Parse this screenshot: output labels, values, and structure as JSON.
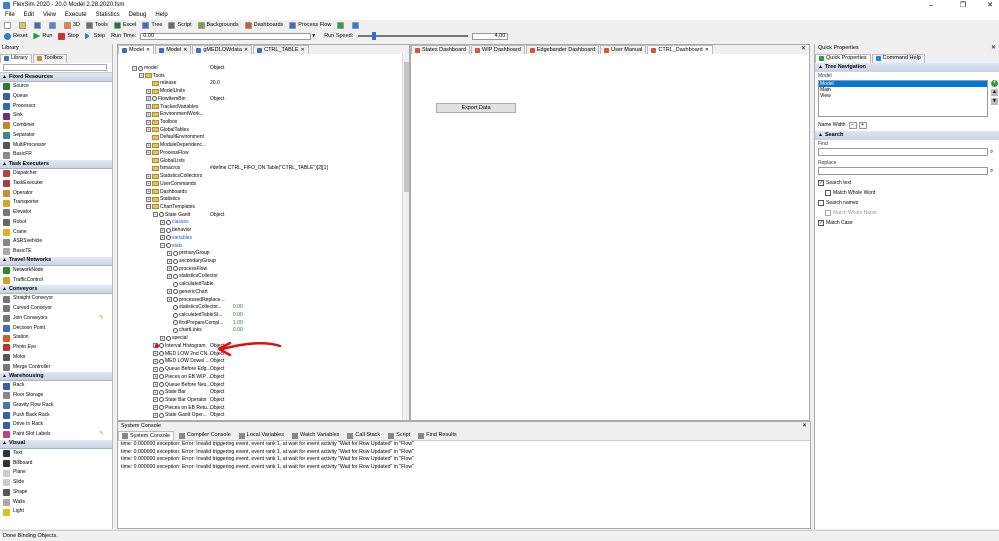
{
  "window": {
    "title": "FlexSim 2020 - 20.0 Model 2.28.2020.fsm",
    "minimize": "–",
    "maximize": "❐",
    "close": "✕"
  },
  "menu": [
    "File",
    "Edit",
    "View",
    "Execute",
    "Statistics",
    "Debug",
    "Help"
  ],
  "toolbar": {
    "items": [
      {
        "label": "",
        "icon": "new-icon",
        "color": "#ffffff"
      },
      {
        "label": "",
        "icon": "open-icon",
        "color": "#e8c05a"
      },
      {
        "label": "",
        "icon": "save-icon",
        "color": "#3a6fc4"
      },
      {
        "label": "",
        "icon": "connect-icon",
        "color": "#4d88d8"
      },
      {
        "label": "3D",
        "icon": "3d-icon",
        "color": "#f07f2c"
      },
      {
        "label": "Tools",
        "icon": "tools-icon",
        "color": "#6b6b6b"
      },
      {
        "label": "Excel",
        "icon": "excel-icon",
        "color": "#1f7a3e"
      },
      {
        "label": "Tree",
        "icon": "tree-icon",
        "color": "#3a6fc4"
      },
      {
        "label": "Script",
        "icon": "script-icon",
        "color": "#6a6a6a"
      },
      {
        "label": "Backgrounds",
        "icon": "backgrounds-icon",
        "color": "#7da043"
      },
      {
        "label": "Dashboards",
        "icon": "dashboards-icon",
        "color": "#d9552b"
      },
      {
        "label": "Process Flow",
        "icon": "process-flow-icon",
        "color": "#3a6fc4"
      },
      {
        "label": "",
        "icon": "color-icon",
        "color": "#2ba34a"
      },
      {
        "label": "",
        "icon": "help-icon",
        "color": "#2b7fd6"
      }
    ],
    "reset": "Reset",
    "run": "Run",
    "stop": "Stop",
    "step": "Step",
    "run_time_label": "Run Time:",
    "run_time_value": "0.00",
    "run_speed_label": "Run Speed:",
    "run_speed_value": "4.00",
    "run_speed_fraction": 0.13
  },
  "library": {
    "title": "Library",
    "tabs": [
      "Library",
      "Toolbox"
    ],
    "groups": [
      {
        "name": "Fixed Resources",
        "items": [
          {
            "label": "Source",
            "color": "#2a7a2a"
          },
          {
            "label": "Queue",
            "color": "#3a5fa8"
          },
          {
            "label": "Processor",
            "color": "#2b6cb0"
          },
          {
            "label": "Sink",
            "color": "#7a2a7a"
          },
          {
            "label": "Combiner",
            "color": "#c08a1a"
          },
          {
            "label": "Separator",
            "color": "#3a8a8a"
          },
          {
            "label": "MultiProcessor",
            "color": "#555555"
          },
          {
            "label": "BasicFR",
            "color": "#8a8a8a"
          }
        ]
      },
      {
        "name": "Task Executers",
        "items": [
          {
            "label": "Dispatcher",
            "color": "#c04040"
          },
          {
            "label": "TaskExecuter",
            "color": "#a04040"
          },
          {
            "label": "Operator",
            "color": "#d08a30"
          },
          {
            "label": "Transporter",
            "color": "#e0a020"
          },
          {
            "label": "Elevator",
            "color": "#777777"
          },
          {
            "label": "Robot",
            "color": "#666666"
          },
          {
            "label": "Crane",
            "color": "#e0b020"
          },
          {
            "label": "ASRSvehicle",
            "color": "#888888"
          },
          {
            "label": "BasicTE",
            "color": "#aaaaaa"
          }
        ]
      },
      {
        "name": "Travel Networks",
        "items": [
          {
            "label": "NetworkNode",
            "color": "#2a8a2a"
          },
          {
            "label": "TrafficControl",
            "color": "#d0a020"
          }
        ]
      },
      {
        "name": "Conveyors",
        "items": [
          {
            "label": "Straight Conveyor",
            "color": "#777777"
          },
          {
            "label": "Curved Conveyor",
            "color": "#777777"
          },
          {
            "label": "Join Conveyors",
            "color": "#777777"
          },
          {
            "label": "Decision Point",
            "color": "#3a6fc4"
          },
          {
            "label": "Station",
            "color": "#d06020"
          },
          {
            "label": "Photo Eye",
            "color": "#c03030"
          },
          {
            "label": "Motor",
            "color": "#555555"
          },
          {
            "label": "Merge Controller",
            "color": "#777777"
          }
        ]
      },
      {
        "name": "Warehousing",
        "items": [
          {
            "label": "Rack",
            "color": "#3a5fa8"
          },
          {
            "label": "Floor Storage",
            "color": "#888888"
          },
          {
            "label": "Gravity Flow Rack",
            "color": "#3a7ab0"
          },
          {
            "label": "Push Back Rack",
            "color": "#3a5fa8"
          },
          {
            "label": "Drive In Rack",
            "color": "#3a5fa8"
          },
          {
            "label": "Paint Slot Labels",
            "color": "#c04080"
          }
        ]
      },
      {
        "name": "Visual",
        "items": [
          {
            "label": "Text",
            "color": "#333333"
          },
          {
            "label": "Billboard",
            "color": "#333333"
          },
          {
            "label": "Plane",
            "color": "#cccccc"
          },
          {
            "label": "Slide",
            "color": "#cccccc"
          },
          {
            "label": "Shape",
            "color": "#555555"
          },
          {
            "label": "Walls",
            "color": "#aaaaaa"
          },
          {
            "label": "Light",
            "color": "#e0c020"
          }
        ]
      }
    ]
  },
  "tree_tabs": [
    "Model",
    "Model",
    "gMEDLOWdata",
    "CTRL_TABLE"
  ],
  "tree": [
    {
      "label": "model",
      "value": "Object",
      "level": 0,
      "kind": "obj",
      "exp": "−"
    },
    {
      "label": "Tools",
      "value": "",
      "level": 1,
      "kind": "fold",
      "exp": "−"
    },
    {
      "label": "release",
      "value": "20.0",
      "level": 2,
      "kind": "fold",
      "exp": ""
    },
    {
      "label": "ModelUnits",
      "value": "",
      "level": 2,
      "kind": "fold",
      "exp": "+"
    },
    {
      "label": "FlowItemBin",
      "value": "Object",
      "level": 2,
      "kind": "obj",
      "exp": "+"
    },
    {
      "label": "TrackedVariables",
      "value": "",
      "level": 2,
      "kind": "fold",
      "exp": "+"
    },
    {
      "label": "EnvironmentWork...",
      "value": "",
      "level": 2,
      "kind": "fold",
      "exp": "+"
    },
    {
      "label": "Toolbox",
      "value": "",
      "level": 2,
      "kind": "fold",
      "exp": "+"
    },
    {
      "label": "GlobalTables",
      "value": "",
      "level": 2,
      "kind": "fold",
      "exp": "+"
    },
    {
      "label": "DefaultEnvironment",
      "value": "",
      "level": 2,
      "kind": "fold",
      "exp": ""
    },
    {
      "label": "ModuleDependenc...",
      "value": "",
      "level": 2,
      "kind": "fold",
      "exp": "+"
    },
    {
      "label": "ProcessFlow",
      "value": "",
      "level": 2,
      "kind": "fold",
      "exp": "+"
    },
    {
      "label": "GlobalLists",
      "value": "",
      "level": 2,
      "kind": "fold",
      "exp": ""
    },
    {
      "label": "fsmacros",
      "value": "#define CTRL_FIFO_ON Table(\"CTRL_TABLE\")[2][1]",
      "level": 2,
      "kind": "fold",
      "exp": ""
    },
    {
      "label": "StatisticsCollectors",
      "value": "",
      "level": 2,
      "kind": "fold",
      "exp": "+"
    },
    {
      "label": "UserCommands",
      "value": "",
      "level": 2,
      "kind": "fold",
      "exp": "+"
    },
    {
      "label": "Dashboards",
      "value": "",
      "level": 2,
      "kind": "fold",
      "exp": "+"
    },
    {
      "label": "Statistics",
      "value": "",
      "level": 2,
      "kind": "fold",
      "exp": "+"
    },
    {
      "label": "ChartTemplates",
      "value": "",
      "level": 2,
      "kind": "fold",
      "exp": "−"
    },
    {
      "label": "State Gantt",
      "value": "Object",
      "level": 3,
      "kind": "obj",
      "exp": "−"
    },
    {
      "label": "classes",
      "value": "",
      "level": 4,
      "kind": "obj",
      "exp": "+",
      "blue": true
    },
    {
      "label": "behavior",
      "value": "",
      "level": 4,
      "kind": "obj",
      "exp": "+"
    },
    {
      "label": "variables",
      "value": "",
      "level": 4,
      "kind": "obj",
      "exp": "+",
      "blue": true
    },
    {
      "label": "stats",
      "value": "",
      "level": 4,
      "kind": "obj",
      "exp": "−",
      "blue": true
    },
    {
      "label": "primaryGroup",
      "value": "",
      "level": 5,
      "kind": "obj",
      "exp": "+"
    },
    {
      "label": "secondaryGroup",
      "value": "",
      "level": 5,
      "kind": "obj",
      "exp": "+"
    },
    {
      "label": "processFlow",
      "value": "",
      "level": 5,
      "kind": "obj",
      "exp": "+"
    },
    {
      "label": "statisticsCollector",
      "value": "",
      "level": 5,
      "kind": "obj",
      "exp": "+"
    },
    {
      "label": "calculatedTable",
      "value": "",
      "level": 5,
      "kind": "obj",
      "exp": ""
    },
    {
      "label": "genericChart",
      "value": "",
      "level": 5,
      "kind": "obj",
      "exp": "+"
    },
    {
      "label": "processedReplace...",
      "value": "",
      "level": 5,
      "kind": "obj",
      "exp": "+"
    },
    {
      "label": "statisticsCollector...",
      "value": "0.00",
      "level": 5,
      "kind": "obj",
      "exp": ""
    },
    {
      "label": "calculatedTableSt...",
      "value": "0.00",
      "level": 5,
      "kind": "obj",
      "exp": ""
    },
    {
      "label": "firstPrepareCompl...",
      "value": "1.00",
      "level": 5,
      "kind": "obj",
      "exp": ""
    },
    {
      "label": "chartLinks",
      "value": "0.00",
      "level": 5,
      "kind": "obj",
      "exp": ""
    },
    {
      "label": "special",
      "value": "",
      "level": 4,
      "kind": "obj",
      "exp": "+"
    },
    {
      "label": "Interval Histogram",
      "value": "Object",
      "level": 3,
      "kind": "obj",
      "exp": "+",
      "marker": true
    },
    {
      "label": "MED LOW 2nd CN...",
      "value": "Object",
      "level": 3,
      "kind": "obj",
      "exp": "+"
    },
    {
      "label": "MED LOW Dowel ...",
      "value": "Object",
      "level": 3,
      "kind": "obj",
      "exp": "+"
    },
    {
      "label": "Queue Before Edg...",
      "value": "Object",
      "level": 3,
      "kind": "obj",
      "exp": "+"
    },
    {
      "label": "Pieces on EB WIP ...",
      "value": "Object",
      "level": 3,
      "kind": "obj",
      "exp": "+"
    },
    {
      "label": "Queue Before Nes...",
      "value": "Object",
      "level": 3,
      "kind": "obj",
      "exp": "+"
    },
    {
      "label": "State Bar",
      "value": "Object",
      "level": 3,
      "kind": "obj",
      "exp": "+"
    },
    {
      "label": "State Bar Operator",
      "value": "Object",
      "level": 3,
      "kind": "obj",
      "exp": "+"
    },
    {
      "label": "Pieces on EB Retu...",
      "value": "Object",
      "level": 3,
      "kind": "obj",
      "exp": "+"
    },
    {
      "label": "State Gantt Oper...",
      "value": "Object",
      "level": 3,
      "kind": "obj",
      "exp": "+"
    }
  ],
  "dash_tabs": [
    "States Dashboard",
    "WIP Dashboard",
    "Edgebander Dashboard",
    "User Manual",
    "CTRL_Dashboard"
  ],
  "export_button": "Export Data",
  "console": {
    "title": "System Console",
    "tabs": [
      "System Console",
      "Compiler Console",
      "Local Variables",
      "Watch Variables",
      "Call Stack",
      "Script",
      "Find Results"
    ],
    "lines": [
      "time: 0.000000 exception: Error: Invalid triggering event, event rank 1, at wait for event activity \"Wait for Row Updated\" in \"Flow\"",
      "time: 0.000000 exception: Error: Invalid triggering event, event rank 1, at wait for event activity \"Wait for Row Updated\" in \"Flow\"",
      "time: 0.000000 exception: Error: Invalid triggering event, event rank 1, at wait for event activity \"Wait for Row Updated\" in \"Flow\"",
      "time: 0.000000 exception: Error: Invalid triggering event, event rank 1, at wait for event activity \"Wait for Row Updated\" in \"Flow\""
    ]
  },
  "quick_properties": {
    "title": "Quick Properties",
    "tabs": [
      "Quick Properties",
      "Command Help"
    ],
    "tree_nav": {
      "title": "Tree Navigation",
      "label": "Model",
      "items": [
        "Model",
        "Main",
        "View"
      ],
      "selected": 0,
      "name_width_label": "Name Width",
      "minus": "−",
      "plus": "+"
    },
    "search": {
      "title": "Search",
      "find_label": "Find",
      "replace_label": "Replace",
      "options": [
        {
          "label": "Search text",
          "checked": true,
          "indent": false,
          "disabled": false
        },
        {
          "label": "Match Whole Word",
          "checked": false,
          "indent": true,
          "disabled": false
        },
        {
          "label": "Search names",
          "checked": false,
          "indent": false,
          "disabled": false
        },
        {
          "label": "Match Whole Name",
          "checked": false,
          "indent": true,
          "disabled": true
        },
        {
          "label": "Match Case",
          "checked": true,
          "indent": false,
          "disabled": false
        }
      ]
    }
  },
  "status_bar": "Done Binding Objects."
}
